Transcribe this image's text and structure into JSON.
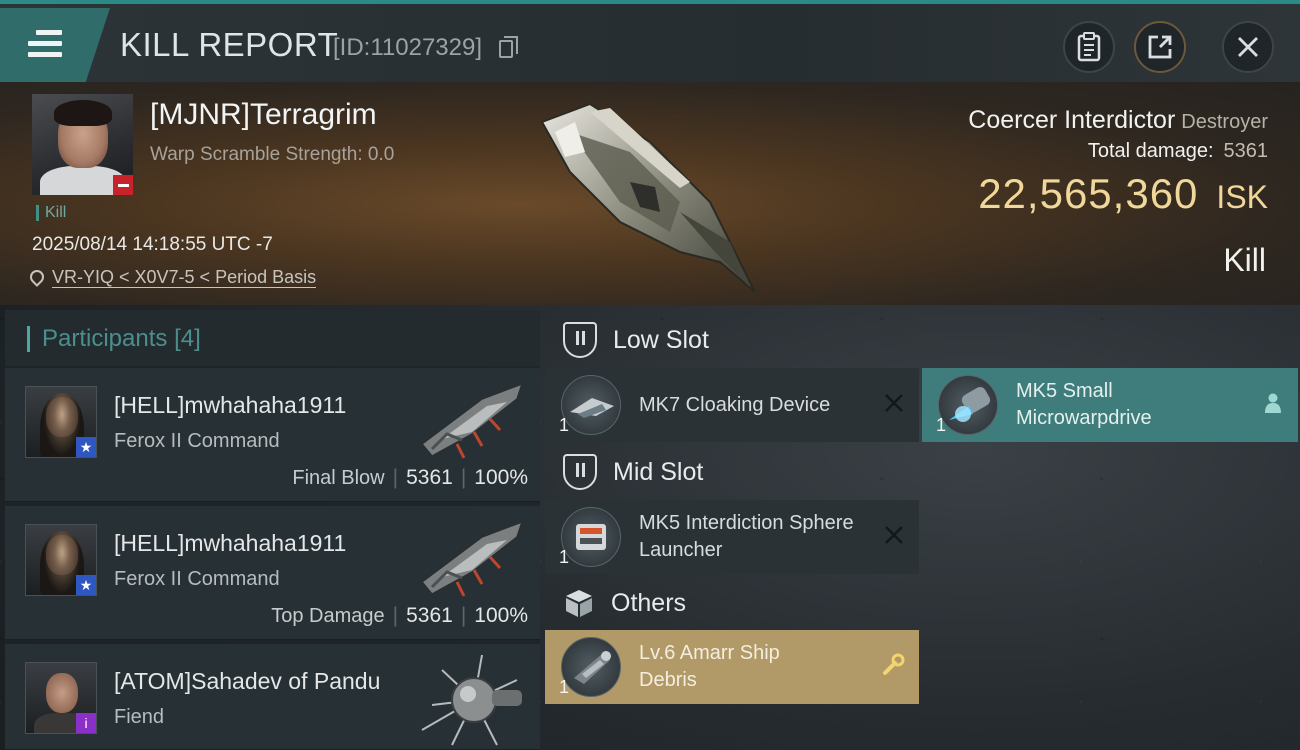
{
  "header": {
    "title": "KILL REPORT",
    "report_id": "[ID:11027329]"
  },
  "victim": {
    "name": "[MJNR]Terragrim",
    "warp_scramble": "Warp Scramble Strength: 0.0",
    "tag": "Kill",
    "timestamp": "2025/08/14 14:18:55 UTC -7",
    "location": "VR-YIQ < X0V7-5 < Period Basis",
    "ship_name": "Coercer Interdictor",
    "ship_class": "Destroyer",
    "total_damage_label": "Total damage:",
    "total_damage": "5361",
    "isk_value": "22,565,360",
    "isk_unit": "ISK",
    "result": "Kill"
  },
  "participants": {
    "title": "Participants",
    "count": "[4]",
    "items": [
      {
        "name": "[HELL]mwhahaha1911",
        "ship": "Ferox II Command",
        "role": "Final Blow",
        "damage": "5361",
        "percent": "100%"
      },
      {
        "name": "[HELL]mwhahaha1911",
        "ship": "Ferox II Command",
        "role": "Top Damage",
        "damage": "5361",
        "percent": "100%"
      },
      {
        "name": "[ATOM]Sahadev of Pandu",
        "ship": "Fiend"
      }
    ]
  },
  "fitting": {
    "low_slot": {
      "label": "Low Slot",
      "modules": [
        {
          "name": "MK7 Cloaking Device",
          "qty": "1"
        },
        {
          "name": "MK5 Small Microwarpdrive",
          "qty": "1"
        }
      ]
    },
    "mid_slot": {
      "label": "Mid Slot",
      "modules": [
        {
          "name": "MK5 Interdiction Sphere Launcher",
          "qty": "1"
        }
      ]
    },
    "others": {
      "label": "Others",
      "modules": [
        {
          "name": "Lv.6 Amarr Ship Debris",
          "qty": "1"
        }
      ]
    }
  },
  "colors": {
    "accent_teal": "#2f6c6a",
    "isk_gold": "#f0d79a",
    "highlight_module": "#3e7d7b",
    "loot_module": "#b19a67",
    "remove_badge": "#c8232a"
  },
  "icons": [
    "menu-icon",
    "copy-icon",
    "clipboard-icon",
    "share-icon",
    "close-icon",
    "location-pin-icon",
    "shield-slot-icon",
    "cube-icon",
    "remove-x-icon",
    "person-icon",
    "wrench-icon"
  ]
}
